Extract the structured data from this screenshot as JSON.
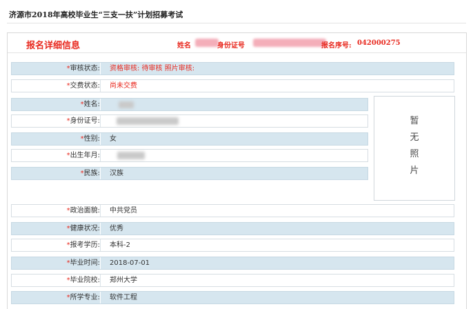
{
  "page": {
    "title": "济源市2018年高校毕业生“三支一扶”计划招募考试"
  },
  "header": {
    "title": "报名详细信息",
    "name_label": "姓名",
    "id_label": "身份证号",
    "serial_label": "报名序号:",
    "serial_value": "042000275"
  },
  "status_rows": [
    {
      "label": "审核状态:",
      "value": "资格审核: 待审核 照片审核:"
    },
    {
      "label": "交费状态:",
      "value": "尚未交费"
    }
  ],
  "person_rows": [
    {
      "label": "姓名:",
      "value": ""
    },
    {
      "label": "身份证号:",
      "value": ""
    },
    {
      "label": "性别:",
      "value": "女"
    },
    {
      "label": "出生年月:",
      "value": ""
    },
    {
      "label": "民族:",
      "value": "汉族"
    }
  ],
  "photo": {
    "placeholder_chars": [
      "暂",
      "无",
      "照",
      "片"
    ]
  },
  "detail_rows": [
    {
      "label": "政治面貌:",
      "value": "中共党员"
    },
    {
      "label": "健康状况:",
      "value": "优秀"
    },
    {
      "label": "报考学历:",
      "value": "本科-2"
    },
    {
      "label": "毕业时间:",
      "value": "2018-07-01"
    },
    {
      "label": "毕业院校:",
      "value": "郑州大学"
    },
    {
      "label": "所学专业:",
      "value": "软件工程"
    }
  ],
  "colors": {
    "accent_red": "#e8281e",
    "row_shade": "#d6e6ef",
    "redaction": "#f4aeb9"
  }
}
